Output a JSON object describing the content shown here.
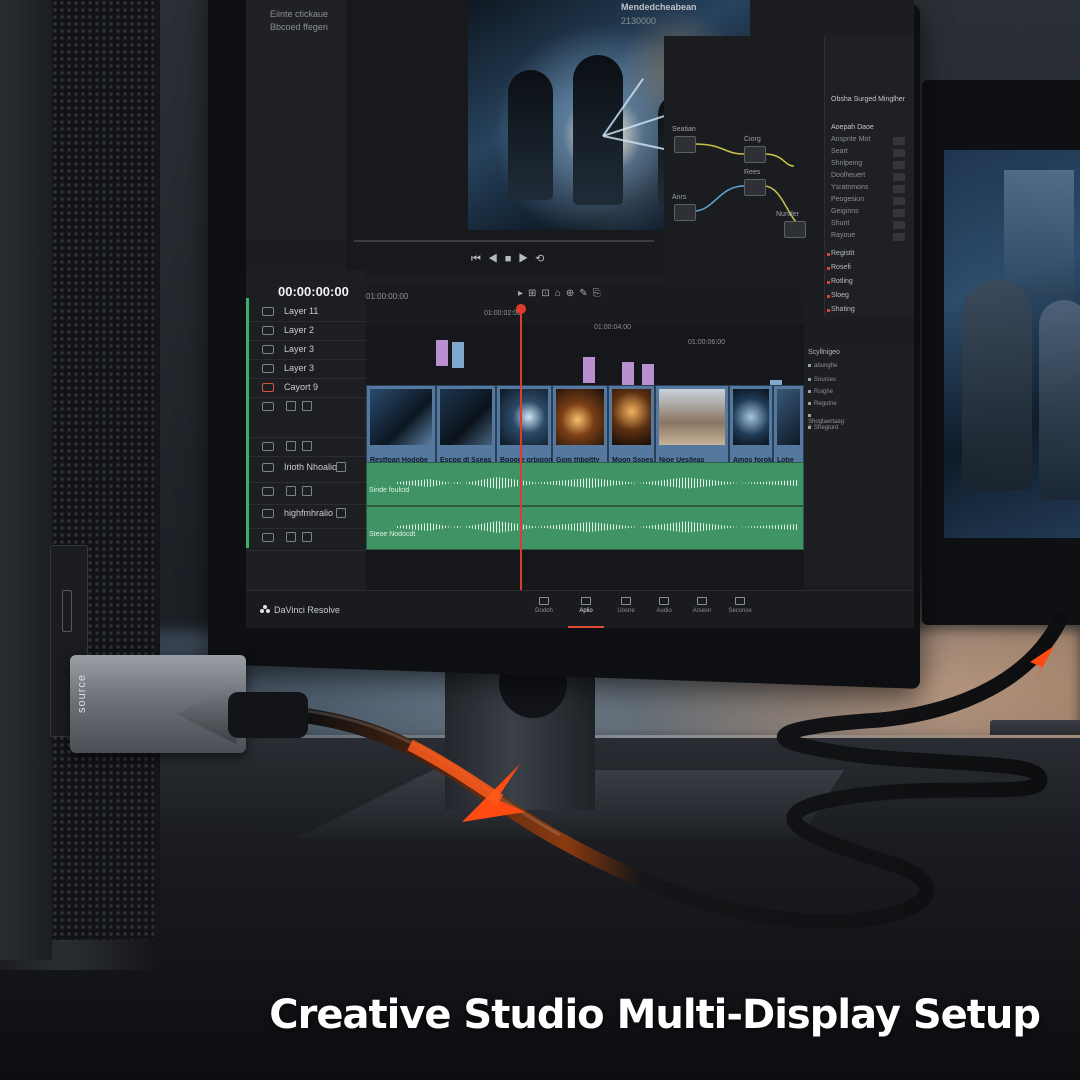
{
  "headline": "Creative Studio Multi-Display Setup",
  "connector_label": "source",
  "app": {
    "name": "DaVinci Resolve",
    "window_title": "Mendedcheabean",
    "window_subtitle": "2130000",
    "media_pool_items": [
      "Eiinte ctickaue",
      "Bbcoed ffegen"
    ],
    "timecode": "00:00:00:00",
    "ruler_timecodes": [
      "01:00:00:00",
      "01:00:02:00",
      "01:00:04:00",
      "01:00:06:00"
    ],
    "video_tracks": [
      "Layer 11",
      "Layer 2",
      "Layer 3",
      "Layer 3",
      "Cayort 9"
    ],
    "audio_tracks": [
      "Irioth Nhoalio",
      "highfmhralio"
    ],
    "clips": [
      "Restfoan Hodobe",
      "Escog dl Sseas",
      "Booore orbigon",
      "Gom thboltty",
      "Moon Ssoes",
      "Nioe Ueslleas",
      "Amos foroke",
      "Lotie"
    ],
    "audio_captions": [
      "Sinde foulcid",
      "Steoe Nodocdt"
    ],
    "nodes": [
      "Seatian",
      "Ciorg",
      "Rees",
      "Anrs",
      "Nunder"
    ],
    "inspector_header": "Obsha Surged Minglher",
    "inspector_section": "Aoepah Daoe",
    "inspector_rows": [
      "Anspnte Mot",
      "Seart",
      "Shnlpeing",
      "Doolheuert",
      "Ysratnmons",
      "Peogesiun",
      "Geiginns",
      "Shunt",
      "Rayoue"
    ],
    "inspector_red": [
      "Registit",
      "Rosefi",
      "Rotling",
      "Sloeg",
      "Shating"
    ],
    "right_panel_title": "Scyllnigeo",
    "right_panel_items": [
      "abunghe",
      "Sources",
      "Ruighe",
      "Regutne",
      "Shogtaertaag 2",
      "Shegturd"
    ],
    "page_tabs": [
      "Dodoh",
      "Aplio",
      "Uosne",
      "Audio",
      "Arsesn",
      "Seconse"
    ],
    "active_page": "Aplio"
  }
}
